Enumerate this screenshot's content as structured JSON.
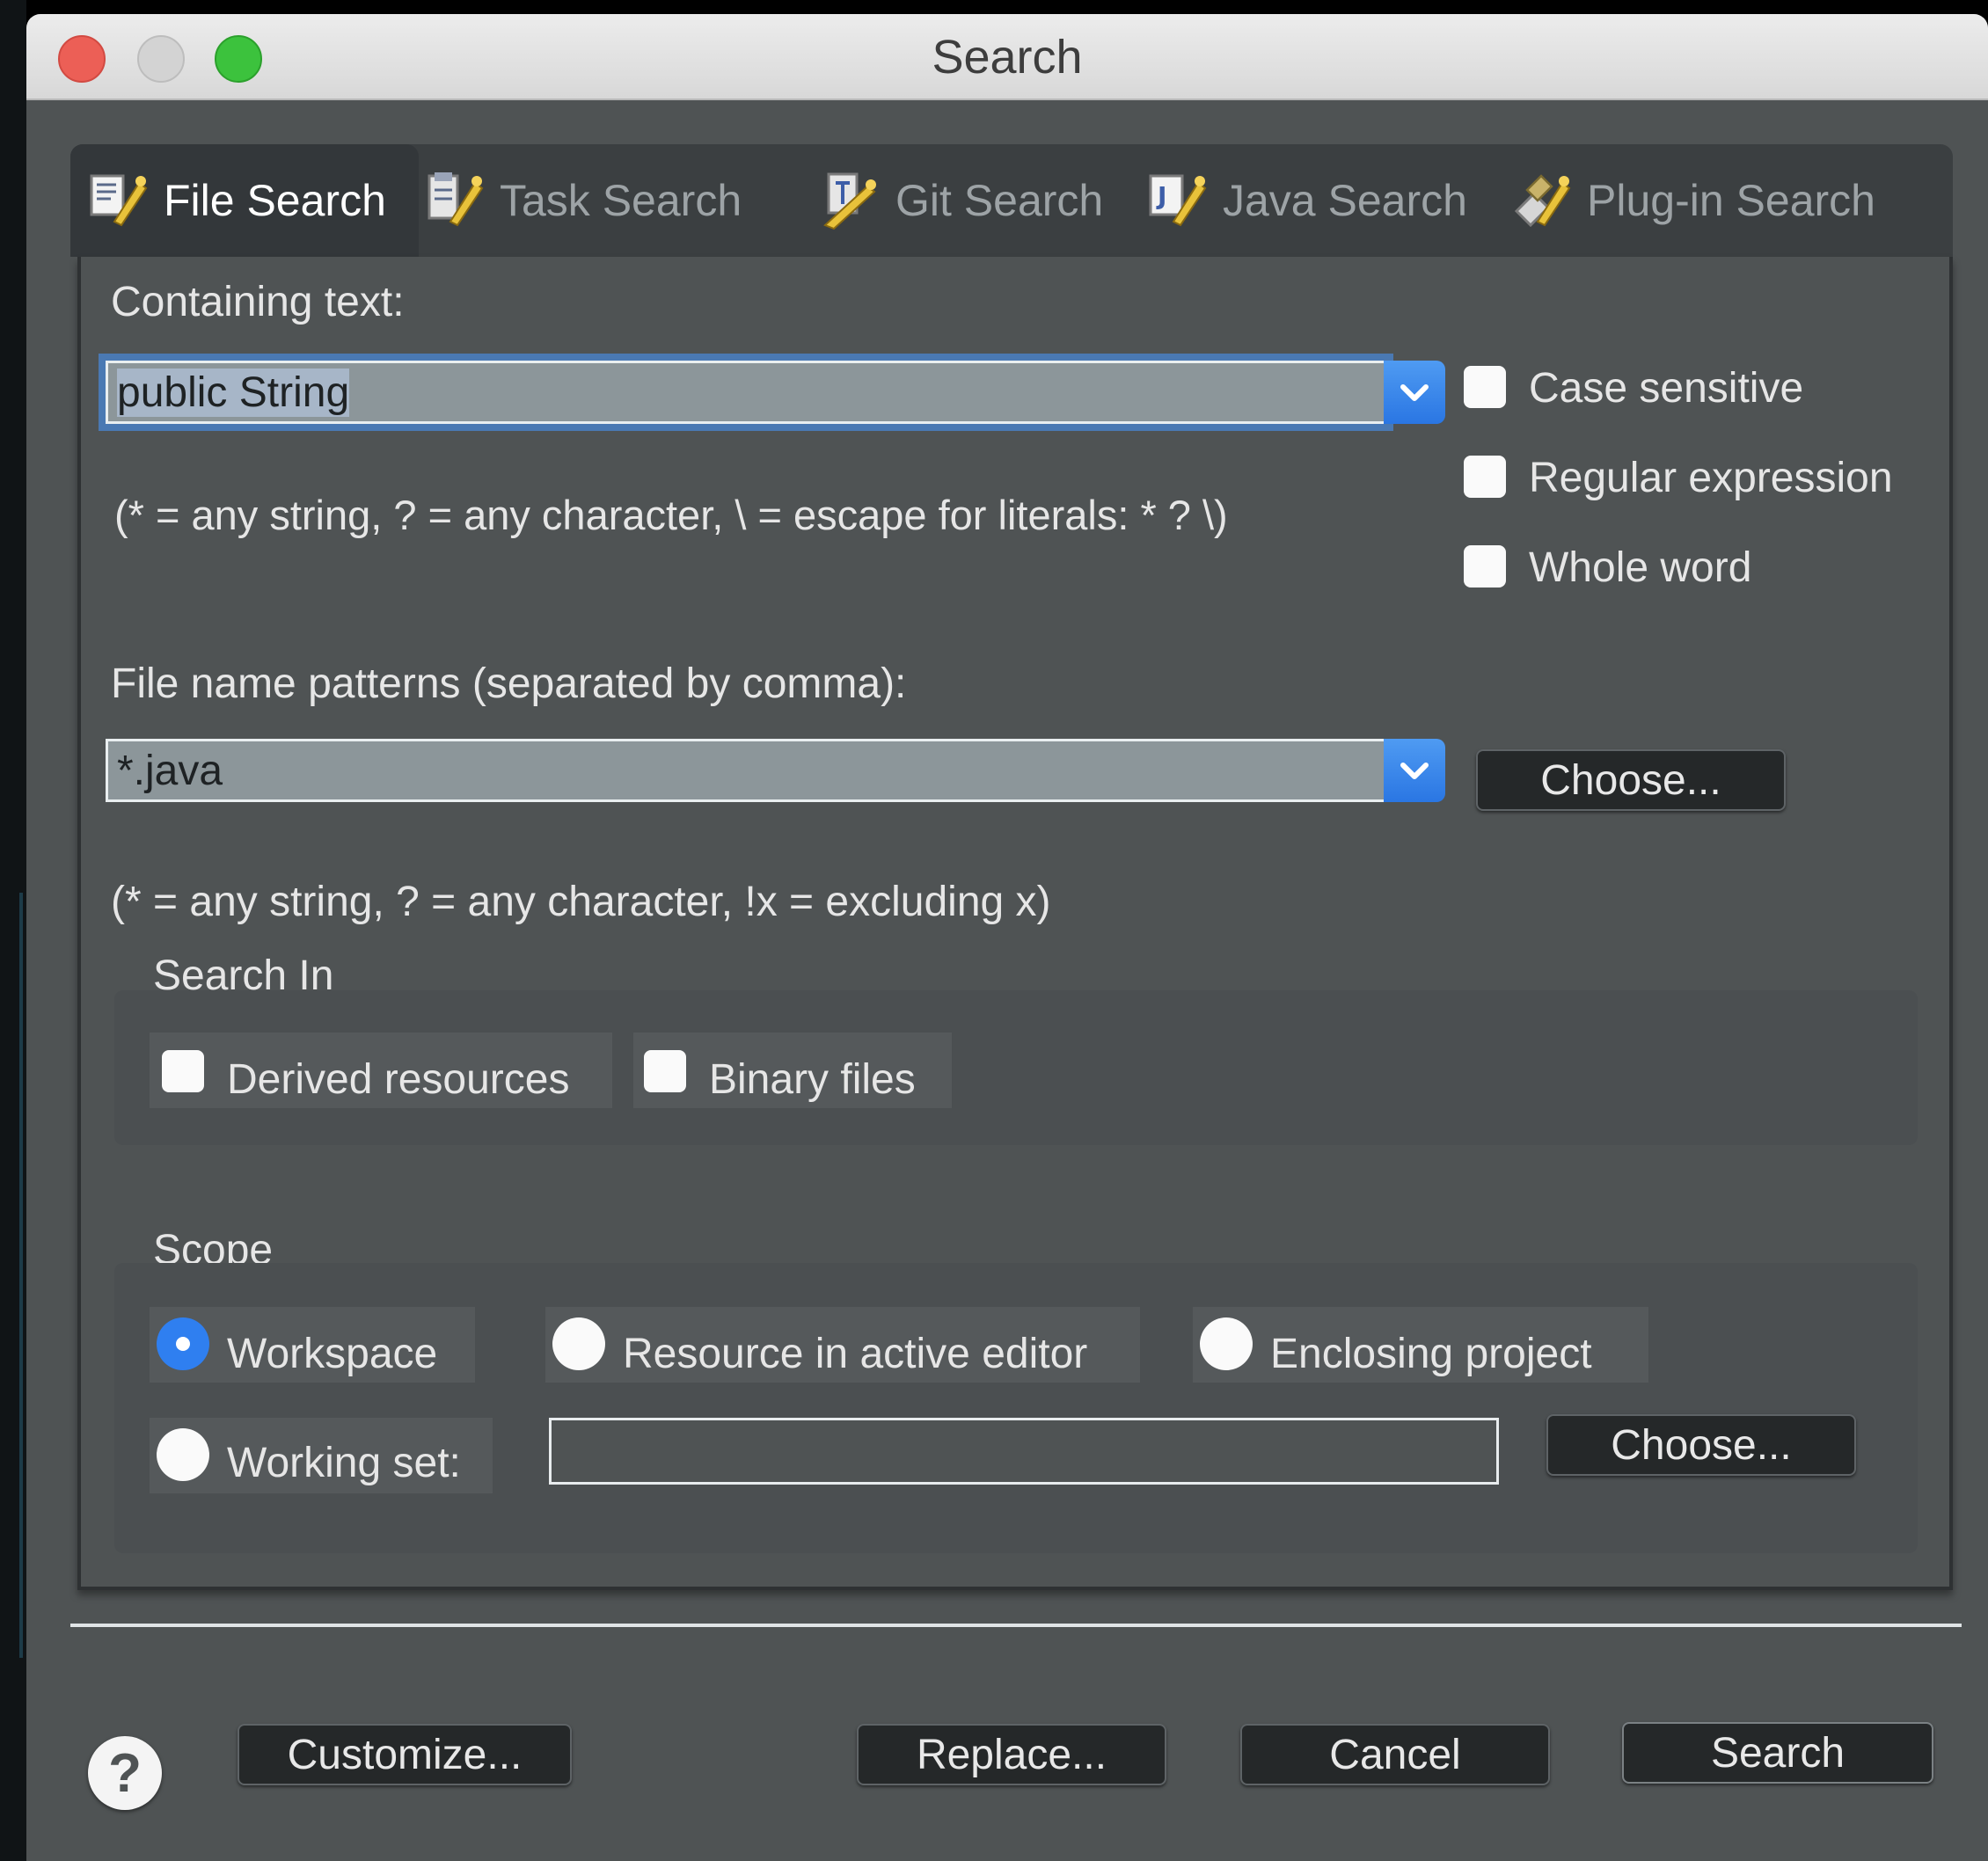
{
  "window": {
    "title": "Search"
  },
  "tabs": [
    {
      "label": "File Search",
      "icon": "file-search-icon",
      "active": true
    },
    {
      "label": "Task Search",
      "icon": "task-search-icon",
      "active": false
    },
    {
      "label": "Git Search",
      "icon": "git-search-icon",
      "active": false
    },
    {
      "label": "Java Search",
      "icon": "java-search-icon",
      "active": false
    },
    {
      "label": "Plug-in Search",
      "icon": "plugin-search-icon",
      "active": false
    }
  ],
  "containing_text": {
    "label": "Containing text:",
    "value": "public String",
    "hint": "(* = any string, ? = any character, \\ = escape for literals: * ? \\)"
  },
  "options": {
    "case_sensitive": {
      "label": "Case sensitive",
      "checked": false
    },
    "regular_expression": {
      "label": "Regular expression",
      "checked": false
    },
    "whole_word": {
      "label": "Whole word",
      "checked": false
    }
  },
  "file_patterns": {
    "label": "File name patterns (separated by comma):",
    "value": "*.java",
    "choose_label": "Choose...",
    "hint": "(* = any string, ? = any character, !x = excluding x)"
  },
  "search_in": {
    "title": "Search In",
    "derived_resources": {
      "label": "Derived resources",
      "checked": false
    },
    "binary_files": {
      "label": "Binary files",
      "checked": false
    }
  },
  "scope": {
    "title": "Scope",
    "workspace": {
      "label": "Workspace",
      "selected": true
    },
    "resource_in_active_editor": {
      "label": "Resource in active editor",
      "selected": false
    },
    "enclosing_project": {
      "label": "Enclosing project",
      "selected": false
    },
    "working_set": {
      "label": "Working set:",
      "selected": false,
      "value": ""
    },
    "choose_label": "Choose..."
  },
  "footer": {
    "customize_label": "Customize...",
    "replace_label": "Replace...",
    "cancel_label": "Cancel",
    "search_label": "Search"
  },
  "colors": {
    "accent": "#2f7ff0",
    "dialog_bg": "#4f5354",
    "button_bg": "#252829"
  }
}
